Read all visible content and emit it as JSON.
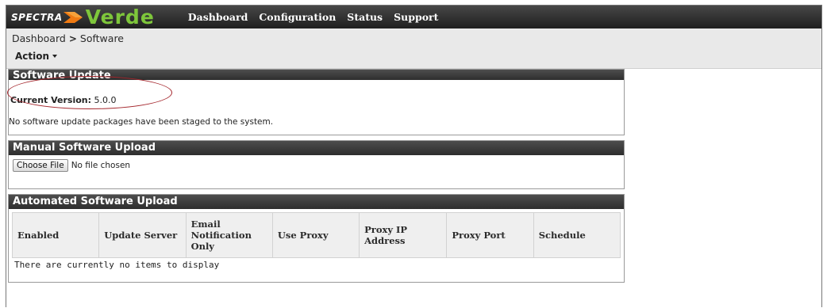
{
  "app": {
    "logo_brand": "SPECTRA",
    "logo_product": "Verde"
  },
  "nav": {
    "items": [
      {
        "label": "Dashboard"
      },
      {
        "label": "Configuration"
      },
      {
        "label": "Status"
      },
      {
        "label": "Support"
      }
    ]
  },
  "breadcrumb": {
    "parent": "Dashboard",
    "separator": ">",
    "current": "Software"
  },
  "action_menu": {
    "label": "Action"
  },
  "software_update": {
    "title": "Software Update",
    "current_version_label": "Current Version:",
    "current_version_value": "5.0.0",
    "message": "No software update packages have been staged to the system."
  },
  "manual_upload": {
    "title": "Manual Software Upload",
    "choose_file_label": "Choose File",
    "file_status": "No file chosen"
  },
  "automated_upload": {
    "title": "Automated Software Upload",
    "columns": [
      "Enabled",
      "Update Server",
      "Email Notification Only",
      "Use Proxy",
      "Proxy IP Address",
      "Proxy Port",
      "Schedule"
    ],
    "empty_message": "There are currently no items to display"
  },
  "colors": {
    "brand_green": "#7ec63b",
    "logo_chevron_orange": "#f07a12",
    "highlight_red": "#a4262c",
    "header_dark": "#333333"
  }
}
